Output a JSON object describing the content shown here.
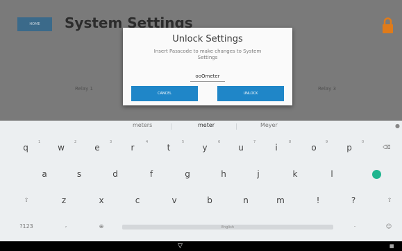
{
  "app": {
    "home_label": "HOME",
    "title": "System Settings",
    "relays": [
      "Relay 1",
      "Relay 3"
    ]
  },
  "dialog": {
    "title": "Unlock Settings",
    "message": "Insert Passcode to make changes to System Settings",
    "input_value": "ooOmeter",
    "cancel_label": "CANCEL",
    "unlock_label": "UNLOCK"
  },
  "keyboard": {
    "suggestions": [
      "meters",
      "meter",
      "Meyer"
    ],
    "row1": [
      "q",
      "w",
      "e",
      "r",
      "t",
      "y",
      "u",
      "i",
      "o",
      "p"
    ],
    "row1_hints": [
      "1",
      "2",
      "3",
      "4",
      "5",
      "6",
      "7",
      "8",
      "9",
      "0"
    ],
    "row2": [
      "a",
      "s",
      "d",
      "f",
      "g",
      "h",
      "j",
      "k",
      "l"
    ],
    "row3": [
      "z",
      "x",
      "c",
      "v",
      "b",
      "n",
      "m",
      "!",
      "?"
    ],
    "symbols_label": "?123",
    "comma_label": ",",
    "period_label": ".",
    "space_label": "English",
    "accent_color": "#1fb58f"
  },
  "colors": {
    "primary_button": "#1f86c8",
    "lock_icon": "#e07b1a"
  },
  "icons": [
    "lock-icon",
    "backspace-icon",
    "shift-icon",
    "enter-icon",
    "globe-icon",
    "emoji-icon",
    "mic-icon",
    "back-icon",
    "keyboard-switch-icon"
  ]
}
